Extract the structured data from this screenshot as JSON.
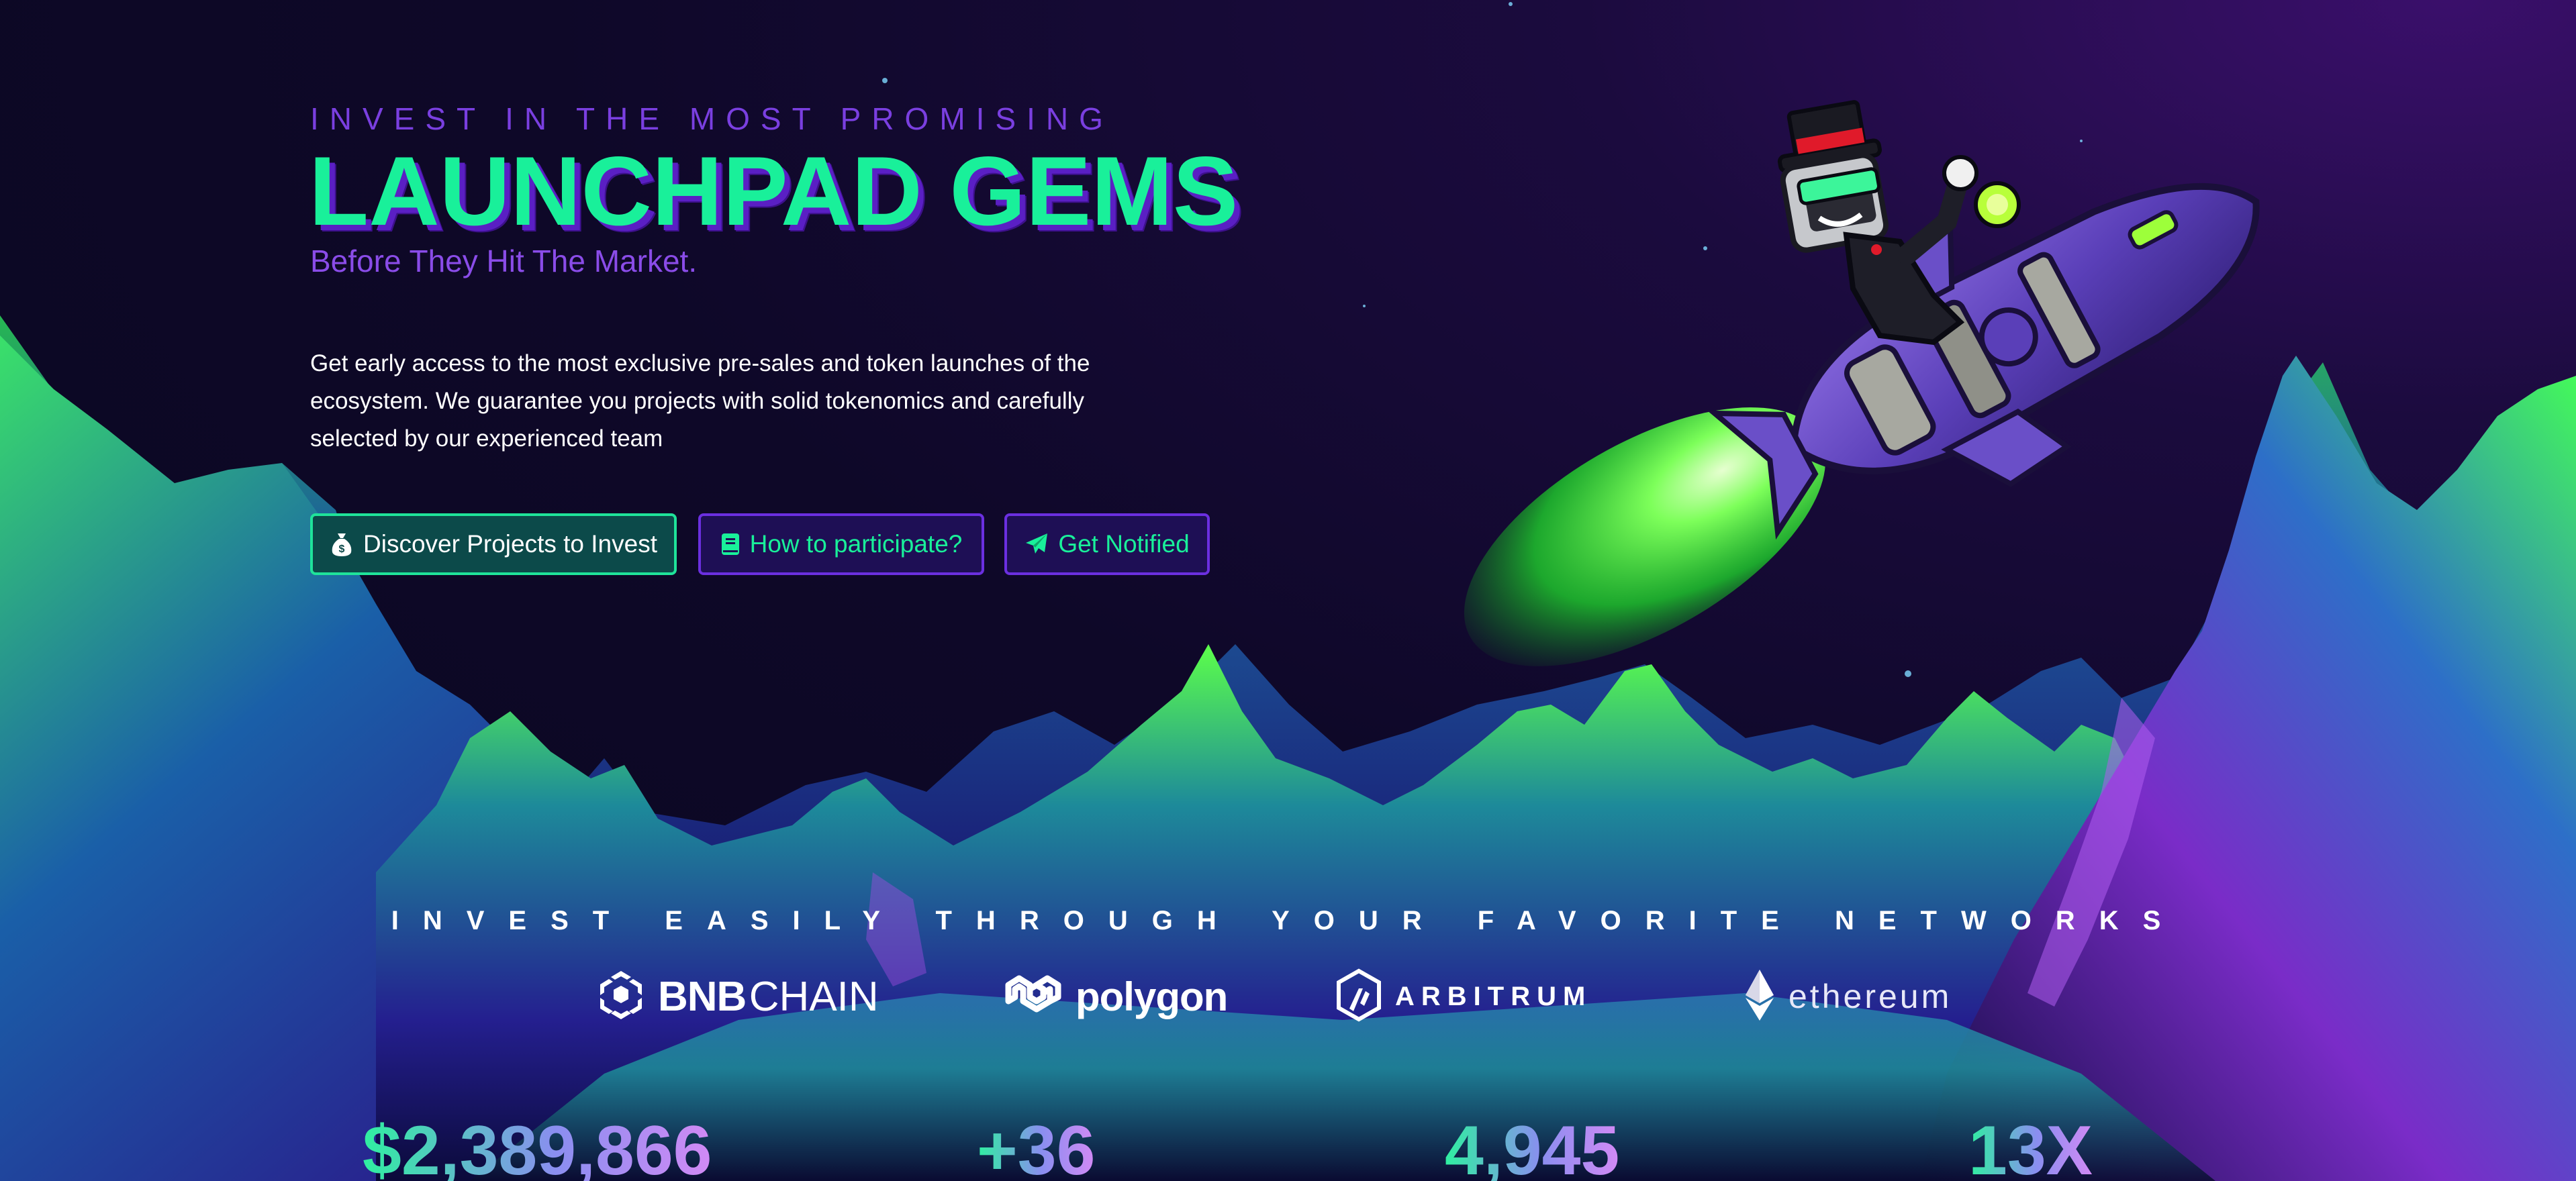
{
  "hero": {
    "kicker": "INVEST IN THE MOST PROMISING",
    "headline": "LAUNCHPAD GEMS",
    "subline": "Before They Hit The Market.",
    "description": "Get early access to the most exclusive pre-sales and token launches of the ecosystem. We guarantee you projects with solid tokenomics and carefully selected by our experienced team"
  },
  "buttons": {
    "discover": {
      "label": "Discover Projects to Invest",
      "icon": "money-bag-icon"
    },
    "participate": {
      "label": "How to participate?",
      "icon": "book-icon"
    },
    "notify": {
      "label": "Get Notified",
      "icon": "paper-plane-icon"
    }
  },
  "networks": {
    "title": "INVEST EASILY THROUGH YOUR FAVORITE NETWORKS",
    "logos": {
      "bnb": {
        "bold": "BNB",
        "rest": "CHAIN"
      },
      "polygon": "polygon",
      "arbitrum": "ARBITRUM",
      "ethereum": "ethereum"
    }
  },
  "stats": [
    "$2,389,866",
    "+36",
    "4,945",
    "13X"
  ],
  "colors": {
    "accent_green": "#19f09a",
    "accent_purple": "#7a3fe0",
    "background": "#0d0826"
  }
}
